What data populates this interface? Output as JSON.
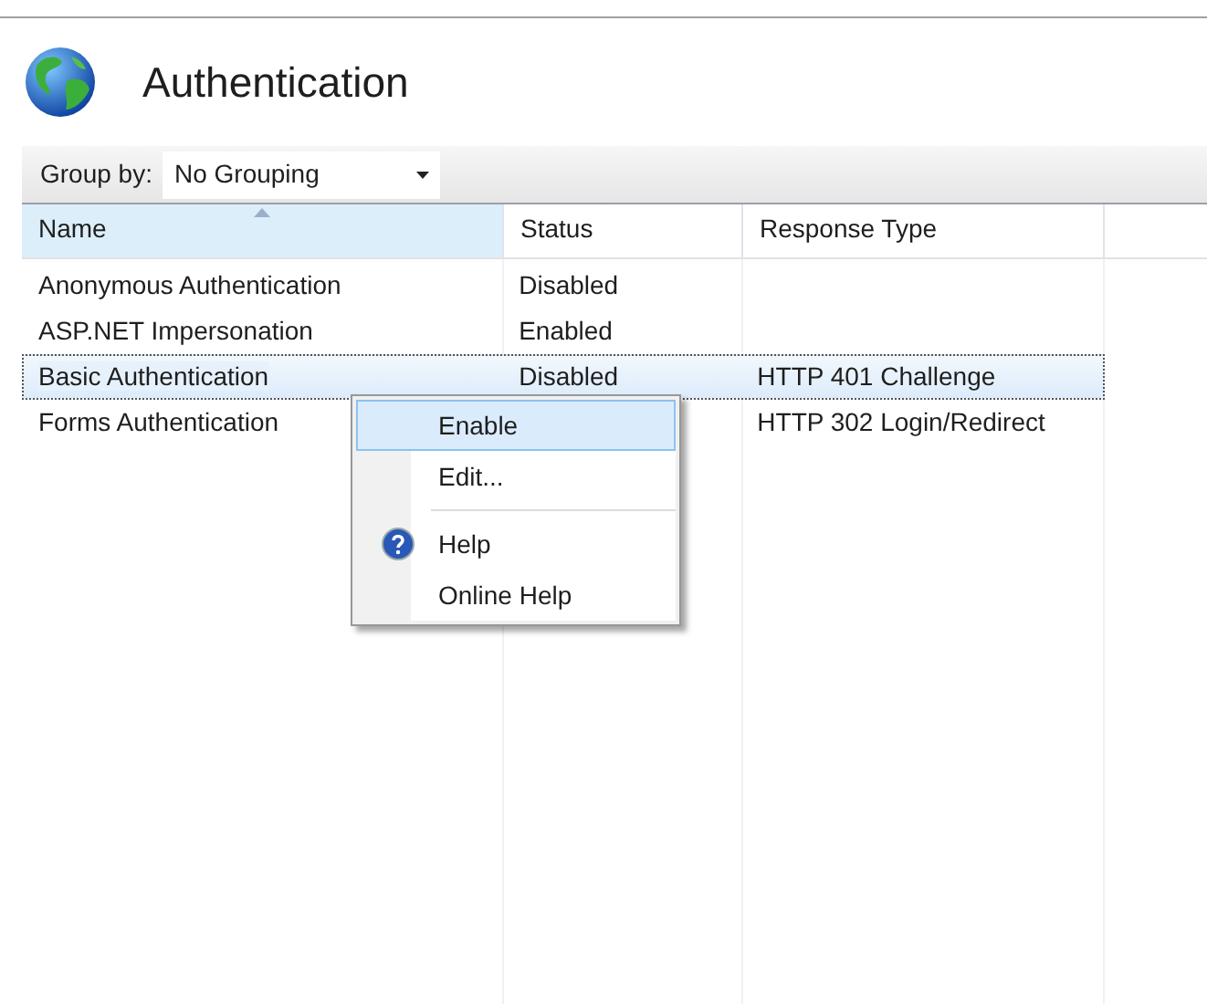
{
  "page": {
    "title": "Authentication"
  },
  "toolbar": {
    "group_by_label": "Group by:",
    "group_by_value": "No Grouping"
  },
  "table": {
    "columns": [
      {
        "label": "Name",
        "sorted": true
      },
      {
        "label": "Status",
        "sorted": false
      },
      {
        "label": "Response Type",
        "sorted": false
      }
    ],
    "rows": [
      {
        "name": "Anonymous Authentication",
        "status": "Disabled",
        "response_type": "",
        "selected": false
      },
      {
        "name": "ASP.NET Impersonation",
        "status": "Enabled",
        "response_type": "",
        "selected": false
      },
      {
        "name": "Basic Authentication",
        "status": "Disabled",
        "response_type": "HTTP 401 Challenge",
        "selected": true
      },
      {
        "name": "Forms Authentication",
        "response_type": "HTTP 302 Login/Redirect",
        "selected": false
      }
    ]
  },
  "context_menu": {
    "items": [
      {
        "kind": "item",
        "label": "Enable",
        "selected": true
      },
      {
        "kind": "item",
        "label": "Edit...",
        "selected": false
      },
      {
        "kind": "separator"
      },
      {
        "kind": "help",
        "label": "Help",
        "selected": false
      },
      {
        "kind": "item",
        "label": "Online Help",
        "selected": false
      }
    ]
  }
}
